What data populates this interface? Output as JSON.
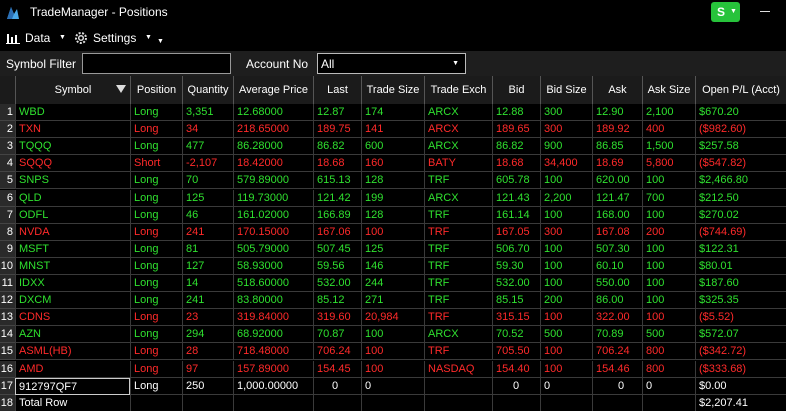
{
  "window": {
    "title": "TradeManager - Positions",
    "status_button": "S"
  },
  "toolbar": {
    "data_label": "Data",
    "settings_label": "Settings"
  },
  "filter": {
    "symbol_label": "Symbol Filter",
    "symbol_value": "",
    "account_label": "Account No",
    "account_value": "All"
  },
  "columns": [
    "Symbol",
    "Position",
    "Quantity",
    "Average Price",
    "Last",
    "Trade Size",
    "Trade Exch",
    "Bid",
    "Bid Size",
    "Ask",
    "Ask Size",
    "Open P/L (Acct)"
  ],
  "rows": [
    {
      "n": "1",
      "color": "green",
      "c": [
        "WBD",
        "Long",
        "3,351",
        "12.68000",
        "12.87",
        "174",
        "ARCX",
        "12.88",
        "300",
        "12.90",
        "2,100",
        "$670.20"
      ]
    },
    {
      "n": "2",
      "color": "red",
      "c": [
        "TXN",
        "Long",
        "34",
        "218.65000",
        "189.75",
        "141",
        "ARCX",
        "189.65",
        "300",
        "189.92",
        "400",
        "($982.60)"
      ]
    },
    {
      "n": "3",
      "color": "green",
      "c": [
        "TQQQ",
        "Long",
        "477",
        "86.28000",
        "86.82",
        "600",
        "ARCX",
        "86.82",
        "900",
        "86.85",
        "1,500",
        "$257.58"
      ]
    },
    {
      "n": "4",
      "color": "red",
      "c": [
        "SQQQ",
        "Short",
        "-2,107",
        "18.42000",
        "18.68",
        "160",
        "BATY",
        "18.68",
        "34,400",
        "18.69",
        "5,800",
        "($547.82)"
      ]
    },
    {
      "n": "5",
      "color": "green",
      "c": [
        "SNPS",
        "Long",
        "70",
        "579.89000",
        "615.13",
        "128",
        "TRF",
        "605.78",
        "100",
        "620.00",
        "100",
        "$2,466.80"
      ]
    },
    {
      "n": "6",
      "color": "green",
      "c": [
        "QLD",
        "Long",
        "125",
        "119.73000",
        "121.42",
        "199",
        "ARCX",
        "121.43",
        "2,200",
        "121.47",
        "700",
        "$212.50"
      ]
    },
    {
      "n": "7",
      "color": "green",
      "c": [
        "ODFL",
        "Long",
        "46",
        "161.02000",
        "166.89",
        "128",
        "TRF",
        "161.14",
        "100",
        "168.00",
        "100",
        "$270.02"
      ]
    },
    {
      "n": "8",
      "color": "red",
      "c": [
        "NVDA",
        "Long",
        "241",
        "170.15000",
        "167.06",
        "100",
        "TRF",
        "167.05",
        "300",
        "167.08",
        "200",
        "($744.69)"
      ]
    },
    {
      "n": "9",
      "color": "green",
      "c": [
        "MSFT",
        "Long",
        "81",
        "505.79000",
        "507.45",
        "125",
        "TRF",
        "506.70",
        "100",
        "507.30",
        "100",
        "$122.31"
      ]
    },
    {
      "n": "10",
      "color": "green",
      "c": [
        "MNST",
        "Long",
        "127",
        "58.93000",
        "59.56",
        "146",
        "TRF",
        "59.30",
        "100",
        "60.10",
        "100",
        "$80.01"
      ]
    },
    {
      "n": "11",
      "color": "green",
      "c": [
        "IDXX",
        "Long",
        "14",
        "518.60000",
        "532.00",
        "244",
        "TRF",
        "532.00",
        "100",
        "550.00",
        "100",
        "$187.60"
      ]
    },
    {
      "n": "12",
      "color": "green",
      "c": [
        "DXCM",
        "Long",
        "241",
        "83.80000",
        "85.12",
        "271",
        "TRF",
        "85.15",
        "200",
        "86.00",
        "100",
        "$325.35"
      ]
    },
    {
      "n": "13",
      "color": "red",
      "c": [
        "CDNS",
        "Long",
        "23",
        "319.84000",
        "319.60",
        "20,984",
        "TRF",
        "315.15",
        "100",
        "322.00",
        "100",
        "($5.52)"
      ]
    },
    {
      "n": "14",
      "color": "green",
      "c": [
        "AZN",
        "Long",
        "294",
        "68.92000",
        "70.87",
        "100",
        "ARCX",
        "70.52",
        "500",
        "70.89",
        "500",
        "$572.07"
      ]
    },
    {
      "n": "15",
      "color": "red",
      "c": [
        "ASML(HB)",
        "Long",
        "28",
        "718.48000",
        "706.24",
        "100",
        "TRF",
        "705.50",
        "100",
        "706.24",
        "800",
        "($342.72)"
      ]
    },
    {
      "n": "16",
      "color": "red",
      "c": [
        "AMD",
        "Long",
        "97",
        "157.89000",
        "154.45",
        "100",
        "NASDAQ",
        "154.40",
        "100",
        "154.46",
        "800",
        "($333.68)"
      ]
    },
    {
      "n": "17",
      "color": "white",
      "c": [
        "912797QF7",
        "Long",
        "250",
        "1,000.00000",
        "0",
        "0",
        "",
        "0",
        "0",
        "0",
        "0",
        "$0.00"
      ]
    },
    {
      "n": "18",
      "color": "white",
      "c": [
        "Total Row",
        "",
        "",
        "",
        "",
        "",
        "",
        "",
        "",
        "",
        "",
        "$2,207.41"
      ]
    }
  ]
}
